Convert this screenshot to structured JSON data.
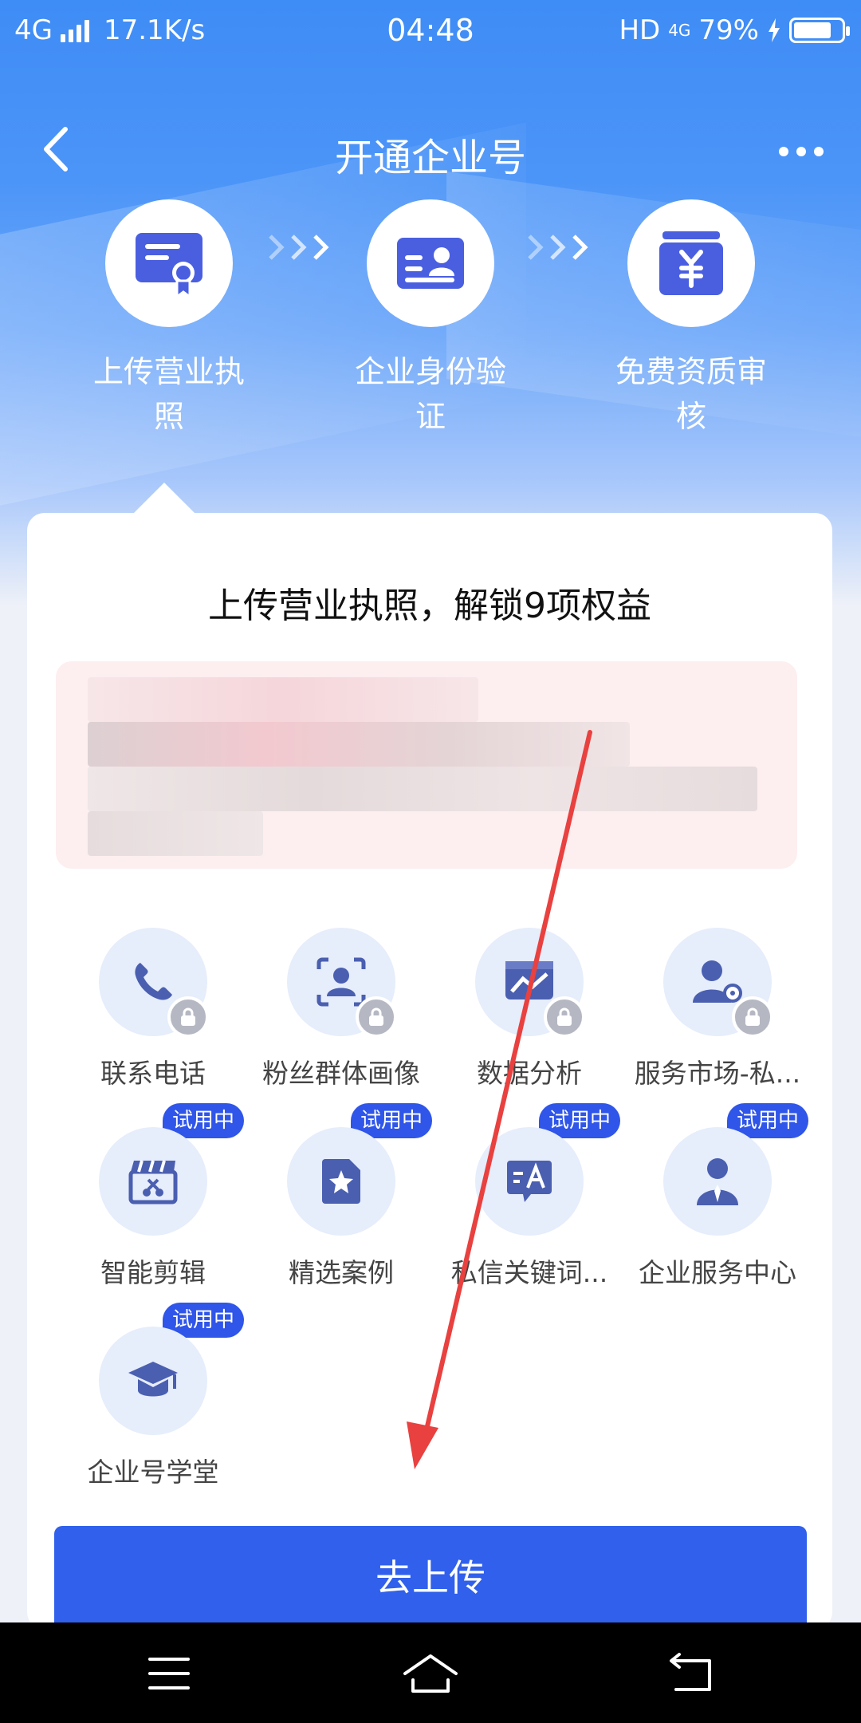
{
  "status_bar": {
    "network": "4G",
    "speed": "17.1K/s",
    "time": "04:48",
    "hd": "HD",
    "net2": "4G",
    "battery": "79%",
    "battery_level": 0.79
  },
  "nav": {
    "title": "开通企业号"
  },
  "steps": [
    {
      "label": "上传营业执照",
      "icon": "certificate-icon"
    },
    {
      "label": "企业身份验证",
      "icon": "id-card-icon"
    },
    {
      "label": "免费资质审核",
      "icon": "yuan-box-icon"
    }
  ],
  "card": {
    "title": "上传营业执照，解锁9项权益",
    "features": [
      {
        "label": "联系电话",
        "locked": true,
        "icon": "phone-icon"
      },
      {
        "label": "粉丝群体画像",
        "locked": true,
        "icon": "face-scan-icon"
      },
      {
        "label": "数据分析",
        "locked": true,
        "icon": "chart-icon"
      },
      {
        "label": "服务市场-私...",
        "locked": true,
        "icon": "user-gear-icon"
      },
      {
        "label": "智能剪辑",
        "badge": "试用中",
        "icon": "clapper-icon"
      },
      {
        "label": "精选案例",
        "badge": "试用中",
        "icon": "star-doc-icon"
      },
      {
        "label": "私信关键词...",
        "badge": "试用中",
        "icon": "message-a-icon"
      },
      {
        "label": "企业服务中心",
        "badge": "试用中",
        "icon": "agent-icon"
      },
      {
        "label": "企业号学堂",
        "badge": "试用中",
        "icon": "graduation-cap-icon"
      }
    ],
    "cta": "去上传"
  },
  "colors": {
    "primary": "#3060ec",
    "hero": "#3e8cf6",
    "badge": "#2f55e9",
    "arrow": "#e8413f"
  }
}
